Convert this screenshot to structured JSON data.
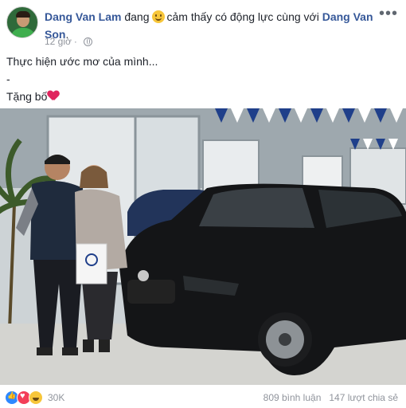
{
  "post": {
    "author": "Dang Van Lam",
    "feeling_prefix": "đang",
    "feeling_emoji": "smiling-face-icon",
    "feeling_text": "cảm thấy có động lực cùng với",
    "tagged_person": "Dang Van Son",
    "tagged_suffix": ".",
    "timestamp": "12 giờ",
    "audience_icon": "globe-icon",
    "more_icon": "more-options-icon",
    "more_glyph": "•••",
    "body_line1": "Thực hiện ước mơ của mình...",
    "body_line2": "-",
    "body_line3": "Tặng bố",
    "body_emoji": "red-heart-icon"
  },
  "photo": {
    "description_icon": "photo",
    "car_badge": "VW",
    "bag_logo": "VW"
  },
  "footer": {
    "reaction_icons": [
      "like-icon",
      "love-icon",
      "haha-icon"
    ],
    "reaction_count": "30K",
    "comments": "809 bình luận",
    "shares": "147 lượt chia sẻ"
  },
  "colors": {
    "link_blue": "#365899",
    "meta_gray": "#90949c",
    "heart_red": "#e0245e"
  }
}
